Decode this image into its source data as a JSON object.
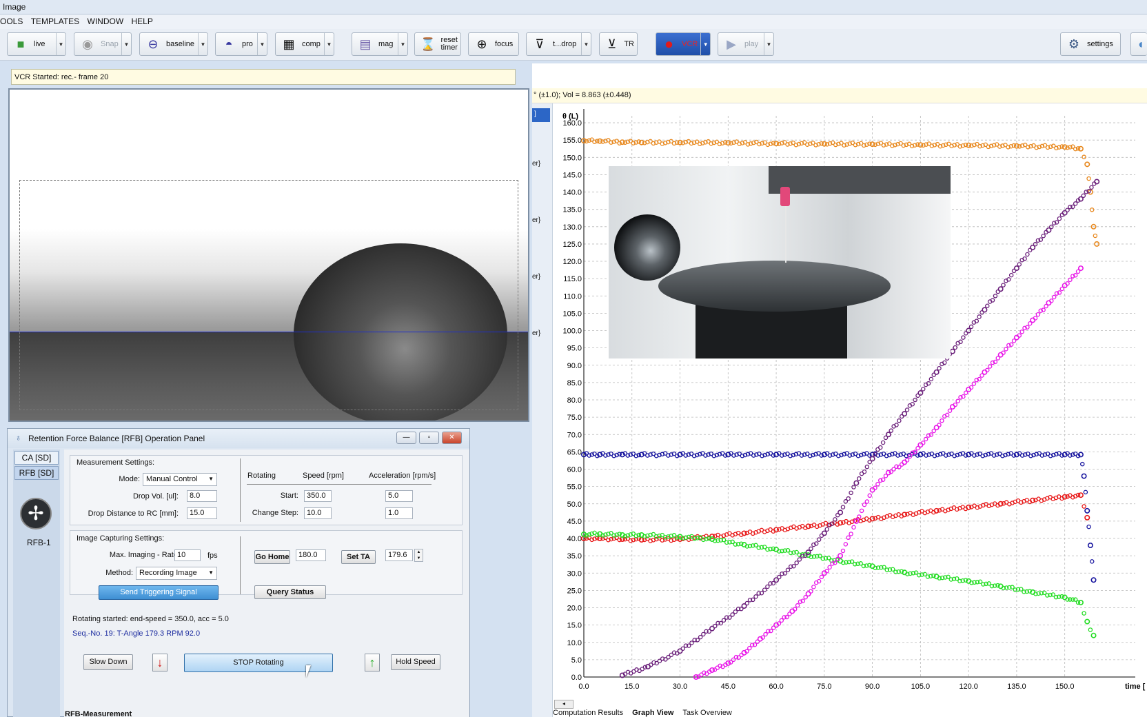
{
  "window": {
    "title": "Image"
  },
  "menu": [
    "OOLS",
    "TEMPLATES",
    "WINDOW",
    "HELP"
  ],
  "toolbar": {
    "live": "live",
    "snap": "Snap",
    "baseline": "baseline",
    "pro": "pro",
    "comp": "comp",
    "mag": "mag",
    "reset_timer_1": "reset",
    "reset_timer_2": "timer",
    "focus": "focus",
    "tdrop": "t...drop",
    "tr": "TR",
    "vcr": "VCR",
    "play": "play",
    "settings": "settings"
  },
  "video": {
    "status": "VCR Started: rec.- frame 20"
  },
  "results": {
    "text": "° (±1.0); Vol = 8.863 (±0.448)"
  },
  "side_strip": [
    "]",
    "er}",
    "er}",
    "er}",
    "er}"
  ],
  "chart_data": {
    "type": "scatter",
    "ylabel": "θ (L)",
    "xlabel": "time [",
    "xlim": [
      0,
      172
    ],
    "ylim": [
      0,
      162
    ],
    "x_ticks": [
      "0.0",
      "15.0",
      "30.0",
      "45.0",
      "60.0",
      "75.0",
      "90.0",
      "105.0",
      "120.0",
      "135.0",
      "150.0"
    ],
    "y_ticks": [
      "160.0",
      "155.0",
      "150.0",
      "145.0",
      "140.0",
      "135.0",
      "130.0",
      "125.0",
      "120.0",
      "115.0",
      "110.0",
      "105.0",
      "100.0",
      "95.0",
      "90.0",
      "85.0",
      "80.0",
      "75.0",
      "70.0",
      "65.0",
      "60.0",
      "55.0",
      "50.0",
      "45.0",
      "40.0",
      "35.0",
      "30.0",
      "25.0",
      "20.0",
      "15.0",
      "10.0",
      "5.0",
      "0.0"
    ],
    "grid": true,
    "series": [
      {
        "color": "#e8891f",
        "x": [
          0,
          5,
          12,
          18,
          30,
          45,
          60,
          75,
          90,
          105,
          120,
          135,
          150,
          155,
          157,
          158,
          159,
          160
        ],
        "y": [
          154.8,
          154.7,
          154.4,
          154.3,
          154.3,
          154.2,
          154.0,
          153.9,
          153.8,
          153.6,
          153.5,
          153.3,
          153.0,
          152.5,
          148,
          140,
          130,
          125
        ]
      },
      {
        "color": "#16139e",
        "x": [
          0,
          5,
          12,
          18,
          30,
          45,
          60,
          75,
          90,
          105,
          120,
          135,
          150,
          155,
          156,
          157,
          158,
          159
        ],
        "y": [
          64.2,
          64.2,
          64.2,
          64.2,
          64.2,
          64.2,
          64.2,
          64.2,
          64.2,
          64.2,
          64.2,
          64.2,
          64.2,
          64.2,
          58,
          48,
          38,
          28
        ]
      },
      {
        "color": "#e81818",
        "x": [
          0,
          5,
          12,
          18,
          30,
          40,
          50,
          60,
          70,
          80,
          90,
          100,
          110,
          120,
          130,
          140,
          150,
          155,
          157
        ],
        "y": [
          40.0,
          40.0,
          39.8,
          39.6,
          39.8,
          40.6,
          41.5,
          42.5,
          43.5,
          44.5,
          45.7,
          46.9,
          48.0,
          49.0,
          50.0,
          51.0,
          52.0,
          52.5,
          46
        ]
      },
      {
        "color": "#22dd22",
        "x": [
          0,
          5,
          12,
          18,
          30,
          40,
          50,
          60,
          70,
          80,
          90,
          100,
          110,
          120,
          130,
          140,
          150,
          155,
          157,
          159
        ],
        "y": [
          41.2,
          41.3,
          41.0,
          41.0,
          40.5,
          39.8,
          38.2,
          36.8,
          35.2,
          33.5,
          32.0,
          30.2,
          29.0,
          27.7,
          26.2,
          24.5,
          23.0,
          21.5,
          16,
          12
        ]
      },
      {
        "color": "#6a1f7a",
        "x": [
          12,
          20,
          30,
          40,
          50,
          60,
          70,
          75,
          80,
          85,
          90,
          95,
          100,
          105,
          110,
          115,
          120,
          125,
          130,
          135,
          140,
          145,
          150,
          155,
          160
        ],
        "y": [
          0.5,
          3,
          7.5,
          14,
          20.5,
          28,
          36,
          41.5,
          47.5,
          56,
          63,
          70,
          76,
          82,
          88,
          94,
          100,
          106,
          112,
          118,
          124,
          129,
          134,
          138,
          143
        ]
      },
      {
        "color": "#e815e8",
        "x": [
          35,
          40,
          45,
          50,
          55,
          60,
          65,
          70,
          75,
          80,
          85,
          90,
          95,
          100,
          105,
          110,
          115,
          120,
          125,
          130,
          135,
          140,
          145,
          150,
          155
        ],
        "y": [
          0,
          2,
          4,
          7,
          11,
          15,
          19,
          24,
          30,
          35,
          45,
          54,
          59,
          62,
          67,
          72,
          78,
          83,
          88,
          93,
          98,
          103,
          108,
          113,
          118
        ]
      }
    ]
  },
  "bottom_tabs": [
    "Computation Results",
    "Graph View",
    "Task Overview"
  ],
  "panel": {
    "title": "Retention Force Balance [RFB] Operation Panel",
    "tabs": [
      "CA [SD]",
      "RFB [SD]"
    ],
    "device_label": "RFB-1",
    "measurement_title": "Measurement Settings:",
    "mode_label": "Mode:",
    "mode_value": "Manual Control",
    "drop_vol_label": "Drop Vol. [ul]:",
    "drop_vol_value": "8.0",
    "drop_dist_label": "Drop Distance to RC [mm]:",
    "drop_dist_value": "15.0",
    "rotating_label": "Rotating",
    "speed_header": "Speed [rpm]",
    "accel_header": "Acceleration [rpm/s]",
    "start_label": "Start:",
    "start_speed": "350.0",
    "start_accel": "5.0",
    "change_label": "Change Step:",
    "change_speed": "10.0",
    "change_accel": "1.0",
    "imaging_title": "Image Capturing Settings:",
    "rate_label": "Max. Imaging - Rate:",
    "rate_value": "10",
    "rate_unit": "fps",
    "method_label": "Method:",
    "method_value": "Recording Image",
    "send_trigger": "Send Triggering Signal",
    "go_home": "Go Home",
    "go_home_value": "180.0",
    "set_ta": "Set TA",
    "set_ta_value": "179.6",
    "query_status": "Query Status",
    "status_line": "Rotating started: end-speed = 350.0, acc = 5.0",
    "seq_line": "Seq.-No.  19: T-Angle 179.3  RPM 92.0",
    "slow_down": "Slow Down",
    "stop_rotating": "STOP Rotating",
    "hold_speed": "Hold Speed",
    "bottom_tab": "RFB-Measurement"
  }
}
